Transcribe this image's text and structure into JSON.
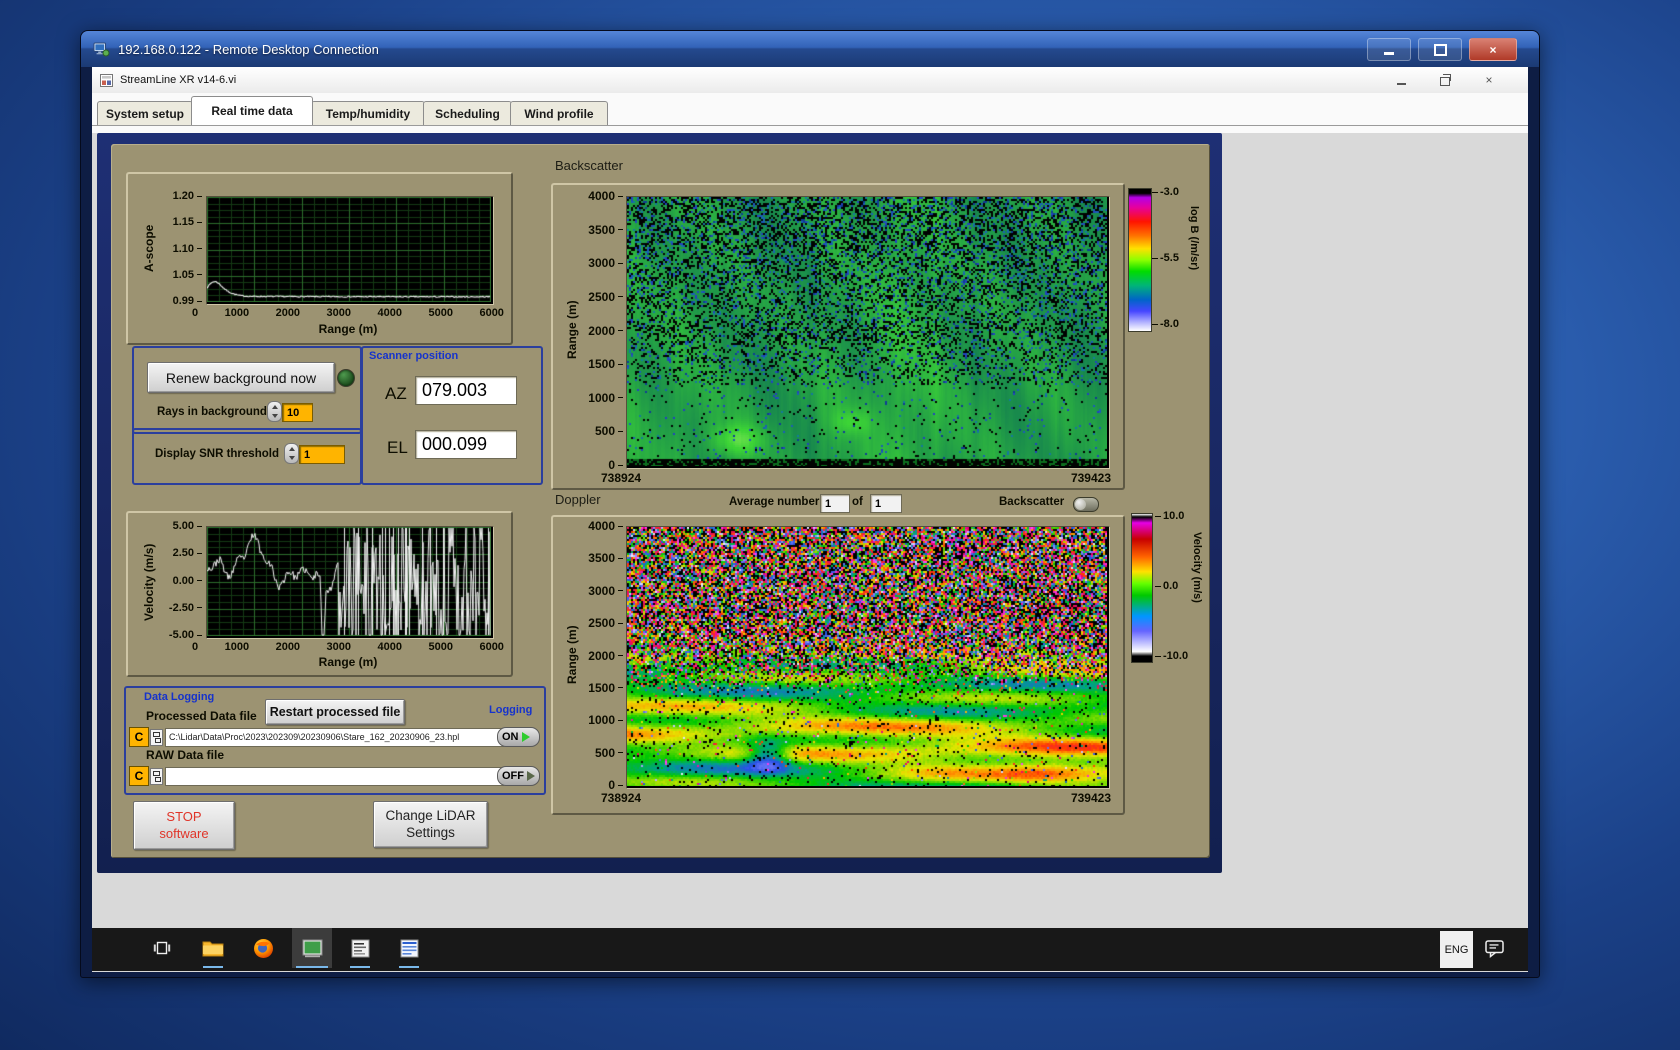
{
  "rdp": {
    "title": "192.168.0.122 - Remote Desktop Connection"
  },
  "vi": {
    "title": "StreamLine XR v14-6.vi"
  },
  "tabs": [
    "System setup",
    "Real time data",
    "Temp/humidity",
    "Scheduling",
    "Wind profile"
  ],
  "panel": {
    "ascope": {
      "ylabel": "A-scope",
      "xlabel": "Range (m)",
      "yticks": [
        "1.20",
        "1.15",
        "1.10",
        "1.05",
        "0.99"
      ],
      "xticks": [
        "0",
        "1000",
        "2000",
        "3000",
        "4000",
        "5000",
        "6000"
      ]
    },
    "background": {
      "renew": "Renew background now",
      "rays_label": "Rays in background",
      "rays_value": "10",
      "snr_label": "Display SNR threshold",
      "snr_value": "1"
    },
    "scanner": {
      "title": "Scanner position",
      "az_label": "AZ",
      "az": "079.003",
      "el_label": "EL",
      "el": "000.099"
    },
    "velocity": {
      "ylabel": "Velocity (m/s)",
      "xlabel": "Range (m)",
      "yticks": [
        "5.00",
        "2.50",
        "0.00",
        "-2.50",
        "-5.00"
      ],
      "xticks": [
        "0",
        "1000",
        "2000",
        "3000",
        "4000",
        "5000",
        "6000"
      ]
    },
    "logging": {
      "title": "Data Logging",
      "processed_label": "Processed Data file",
      "restart": "Restart processed file",
      "logging_label": "Logging",
      "drive": "C",
      "processed_path": "C:\\Lidar\\Data\\Proc\\2023\\202309\\20230906\\Stare_162_20230906_23.hpl",
      "raw_label": "RAW Data file",
      "raw_path": "",
      "on": "ON",
      "off": "OFF"
    },
    "stop": {
      "line1": "STOP",
      "line2": "software"
    },
    "change": {
      "line1": "Change LiDAR",
      "line2": "Settings"
    },
    "backscatter": {
      "title": "Backscatter",
      "ylabel": "Range (m)",
      "yticks": [
        "4000",
        "3500",
        "3000",
        "2500",
        "2000",
        "1500",
        "1000",
        "500",
        "0"
      ],
      "x_left": "738924",
      "x_right": "739423",
      "cb_ticks": [
        "-3.0",
        "-5.5",
        "-8.0"
      ],
      "cb_label": "log B (/m/sr)"
    },
    "doppler": {
      "title": "Doppler",
      "avg_label": "Average number",
      "avg_value": "1",
      "of_label": "of",
      "avg_total": "1",
      "toggle_label": "Backscatter",
      "ylabel": "Range (m)",
      "yticks": [
        "4000",
        "3500",
        "3000",
        "2500",
        "2000",
        "1500",
        "1000",
        "500",
        "0"
      ],
      "x_left": "738924",
      "x_right": "739423",
      "cb_ticks": [
        "10.0",
        "0.0",
        "-10.0"
      ],
      "cb_label": "Velocity (m/s)"
    }
  },
  "taskbar": {
    "language": "ENG"
  },
  "colors": {
    "panel_tan": "#9c9372",
    "panel_navy": "#18265e",
    "label_blue": "#1633cc",
    "amber": "#ffb400",
    "led_green": "#2f6d2f",
    "on_green": "#2ecc2e",
    "titlebar_blue": "#3263b8",
    "grid_green": "#2c6e2c"
  },
  "chart_data": [
    {
      "type": "line",
      "name": "A-scope",
      "ylabel": "A-scope",
      "xlabel": "Range (m)",
      "xlim": [
        0,
        6000
      ],
      "ylim": [
        0.99,
        1.2
      ],
      "yticks": [
        1.2,
        1.15,
        1.1,
        1.05,
        0.99
      ],
      "xticks": [
        0,
        1000,
        2000,
        3000,
        4000,
        5000,
        6000
      ],
      "grid": true,
      "series": [
        {
          "name": "a-scope-trace",
          "summary": "white trace flat near 0.997 with a peak of ~1.025 around 150 m decaying by ~800 m"
        }
      ]
    },
    {
      "type": "line",
      "name": "Velocity",
      "ylabel": "Velocity (m/s)",
      "xlabel": "Range (m)",
      "xlim": [
        0,
        6000
      ],
      "ylim": [
        -5,
        5
      ],
      "yticks": [
        5.0,
        2.5,
        0.0,
        -2.5,
        -5.0
      ],
      "xticks": [
        0,
        1000,
        2000,
        3000,
        4000,
        5000,
        6000
      ],
      "grid": true,
      "series": [
        {
          "name": "velocity-trace",
          "summary": "coherent 0-5 m/s winding trace out to ~2800 m, uncorrelated noise spanning ±5 m/s beyond"
        }
      ]
    },
    {
      "type": "heatmap",
      "name": "Backscatter",
      "ylabel": "Range (m)",
      "ylim": [
        0,
        4000
      ],
      "yticks": [
        4000,
        3500,
        3000,
        2500,
        2000,
        1500,
        1000,
        500,
        0
      ],
      "x_range": [
        738924,
        739423
      ],
      "colorbar": {
        "label": "log B (/m/sr)",
        "ticks": [
          -3.0,
          -5.5,
          -8.0
        ],
        "range": [
          -8.0,
          -3.0
        ]
      },
      "summary": "mostly green (~-5.5) with black/blue speckle noise increasing with altitude; smoother brighter green below ~1200 m with bright blobs near 400-600 m"
    },
    {
      "type": "heatmap",
      "name": "Doppler",
      "ylabel": "Range (m)",
      "ylim": [
        0,
        4000
      ],
      "yticks": [
        4000,
        3500,
        3000,
        2500,
        2000,
        1500,
        1000,
        500,
        0
      ],
      "x_range": [
        738924,
        739423
      ],
      "colorbar": {
        "label": "Velocity (m/s)",
        "ticks": [
          10.0,
          0.0,
          -10.0
        ],
        "range": [
          -10.0,
          10.0
        ]
      },
      "summary": "smooth green/yellow/orange wind field below ~1500 m, random multicolour aliased noise above ~2200 m"
    }
  ]
}
